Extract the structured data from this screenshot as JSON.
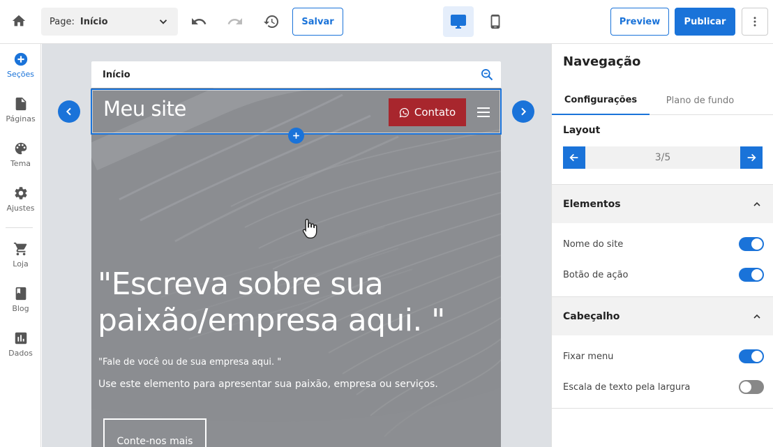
{
  "toolbar": {
    "page_prefix": "Page:",
    "page_value": "Início",
    "save_label": "Salvar",
    "preview_label": "Preview",
    "publish_label": "Publicar"
  },
  "sidebar": {
    "items": [
      {
        "label": "Seções",
        "icon": "plus-circle-icon"
      },
      {
        "label": "Páginas",
        "icon": "file-icon"
      },
      {
        "label": "Tema",
        "icon": "palette-icon"
      },
      {
        "label": "Ajustes",
        "icon": "gear-icon"
      },
      {
        "label": "Loja",
        "icon": "cart-icon"
      },
      {
        "label": "Blog",
        "icon": "book-icon"
      },
      {
        "label": "Dados",
        "icon": "bar-chart-icon"
      }
    ]
  },
  "canvas": {
    "page_name": "Início",
    "site_name": "Meu site",
    "contact_label": "Contato",
    "hero_title": "\"Escreva sobre sua paixão/empresa aqui. \"",
    "hero_sub1": "\"Fale de você ou de sua empresa aqui. \"",
    "hero_sub2": "Use este elemento para apresentar sua paixão, empresa ou serviços.",
    "hero_button": "Conte-nos mais"
  },
  "panel": {
    "title": "Navegação",
    "tabs": [
      "Configurações",
      "Plano de fundo"
    ],
    "layout_label": "Layout",
    "layout_value": "3/5",
    "sections": [
      {
        "title": "Elementos",
        "options": [
          {
            "label": "Nome do site",
            "on": true
          },
          {
            "label": "Botão de ação",
            "on": true
          }
        ]
      },
      {
        "title": "Cabeçalho",
        "options": [
          {
            "label": "Fixar menu",
            "on": true
          },
          {
            "label": "Escala de texto pela largura",
            "on": false
          }
        ]
      }
    ]
  },
  "colors": {
    "accent": "#1a73d9",
    "contact_button": "#a8262d",
    "canvas_bg": "#dde0e4"
  }
}
